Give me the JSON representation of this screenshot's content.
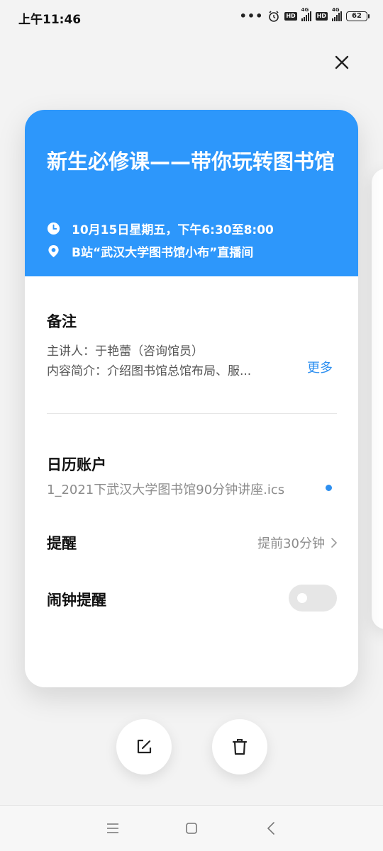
{
  "status_bar": {
    "time": "上午11:46",
    "network_1": "4G",
    "network_2": "4G",
    "hd_label": "HD",
    "battery": "62"
  },
  "event": {
    "title": "新生必修课——带你玩转图书馆",
    "datetime": "10月15日星期五，下午6:30至8:00",
    "location": "B站“武汉大学图书馆小布”直播间",
    "header_color": "#2d97fb"
  },
  "notes": {
    "label": "备注",
    "line1": "主讲人：于艳蕾（咨询馆员）",
    "line2": "内容简介：介绍图书馆总馆布局、服...",
    "more": "更多"
  },
  "calendar_account": {
    "label": "日历账户",
    "value": "1_2021下武汉大学图书馆90分钟讲座.ics",
    "color": "#2d8ff0"
  },
  "reminder": {
    "label": "提醒",
    "value": "提前30分钟"
  },
  "alarm_reminder": {
    "label": "闹钟提醒",
    "enabled": false
  },
  "actions": {
    "edit_icon": "edit-icon",
    "delete_icon": "trash-icon"
  },
  "nav": {
    "menu_icon": "menu-icon",
    "home_icon": "home-icon",
    "back_icon": "back-icon"
  }
}
